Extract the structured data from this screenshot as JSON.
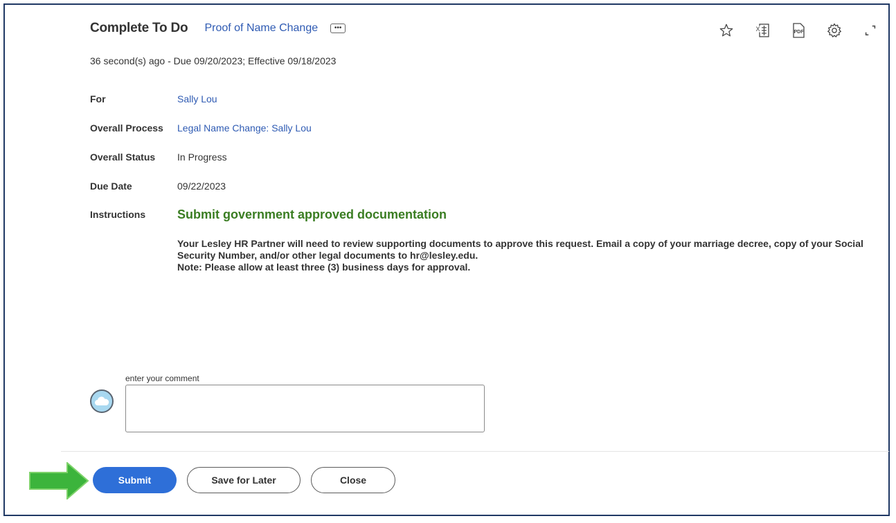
{
  "header": {
    "title": "Complete To Do",
    "subtitle_link": "Proof of Name Change",
    "related_actions_glyph": "•••",
    "meta": "36 second(s) ago - Due 09/20/2023; Effective 09/18/2023"
  },
  "toolbar": {
    "icons": [
      "star-icon",
      "export-excel-icon",
      "export-pdf-icon",
      "gear-icon",
      "expand-icon"
    ],
    "excel_text": "X",
    "pdf_text": "PDF"
  },
  "fields": {
    "for_label": "For",
    "for_value": "Sally Lou",
    "process_label": "Overall Process",
    "process_value": "Legal Name Change: Sally Lou",
    "status_label": "Overall Status",
    "status_value": "In Progress",
    "due_label": "Due Date",
    "due_value": "09/22/2023",
    "instructions_label": "Instructions"
  },
  "instructions": {
    "heading": "Submit government approved documentation",
    "line1": "Your Lesley HR Partner will need to review supporting documents to approve this request. Email a copy of your marriage decree, copy of your Social Security Number, and/or other legal documents to hr@lesley.edu.",
    "line2": "Note: Please allow at least three (3) business days for approval."
  },
  "comment": {
    "label": "enter your comment",
    "value": "",
    "avatar_icon": "cloud-avatar-icon"
  },
  "actions": {
    "submit": "Submit",
    "save_later": "Save for Later",
    "close": "Close"
  },
  "colors": {
    "link": "#2f5bb3",
    "heading_green": "#3a7d22",
    "primary_button": "#2e6fd8",
    "frame_border": "#1f3864",
    "arrow_green": "#3cb43c"
  }
}
